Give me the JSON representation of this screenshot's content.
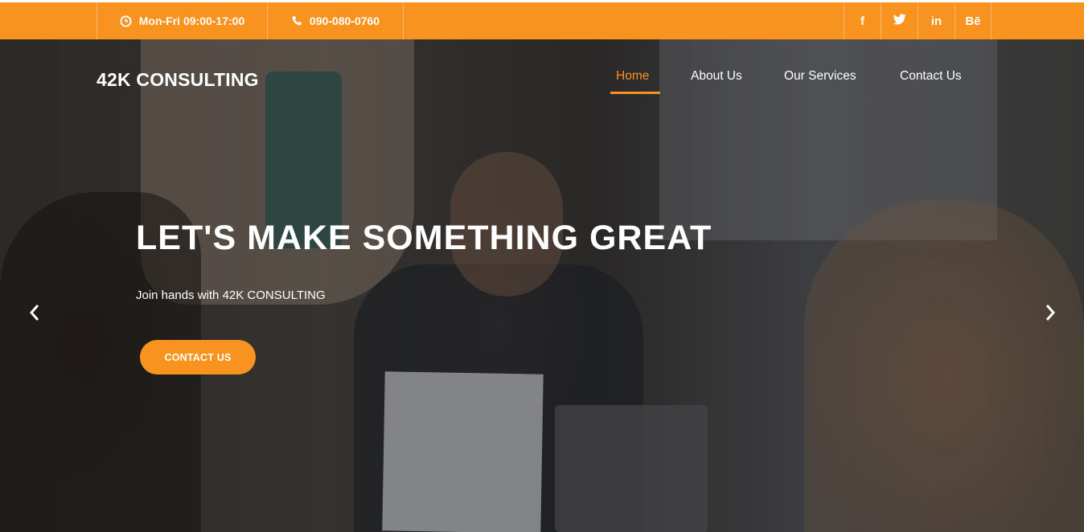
{
  "topbar": {
    "hours": "Mon-Fri 09:00-17:00",
    "phone": "090-080-0760",
    "social": [
      {
        "label": "f",
        "icon": "facebook-icon"
      },
      {
        "label": "twitter",
        "icon": "twitter-icon"
      },
      {
        "label": "in",
        "icon": "linkedin-icon"
      },
      {
        "label": "Bē",
        "icon": "behance-icon"
      }
    ]
  },
  "header": {
    "logo": "42K CONSULTING",
    "nav": [
      {
        "label": "Home",
        "active": true
      },
      {
        "label": "About Us",
        "active": false
      },
      {
        "label": "Our Services",
        "active": false
      },
      {
        "label": "Contact Us",
        "active": false
      }
    ]
  },
  "hero": {
    "headline": "LET'S MAKE SOMETHING GREAT",
    "subtitle": "Join hands with 42K CONSULTING",
    "cta_label": "CONTACT US",
    "prev_icon": "chevron-left-icon",
    "next_icon": "chevron-right-icon"
  },
  "colors": {
    "accent": "#f7931e",
    "text": "#ffffff"
  }
}
